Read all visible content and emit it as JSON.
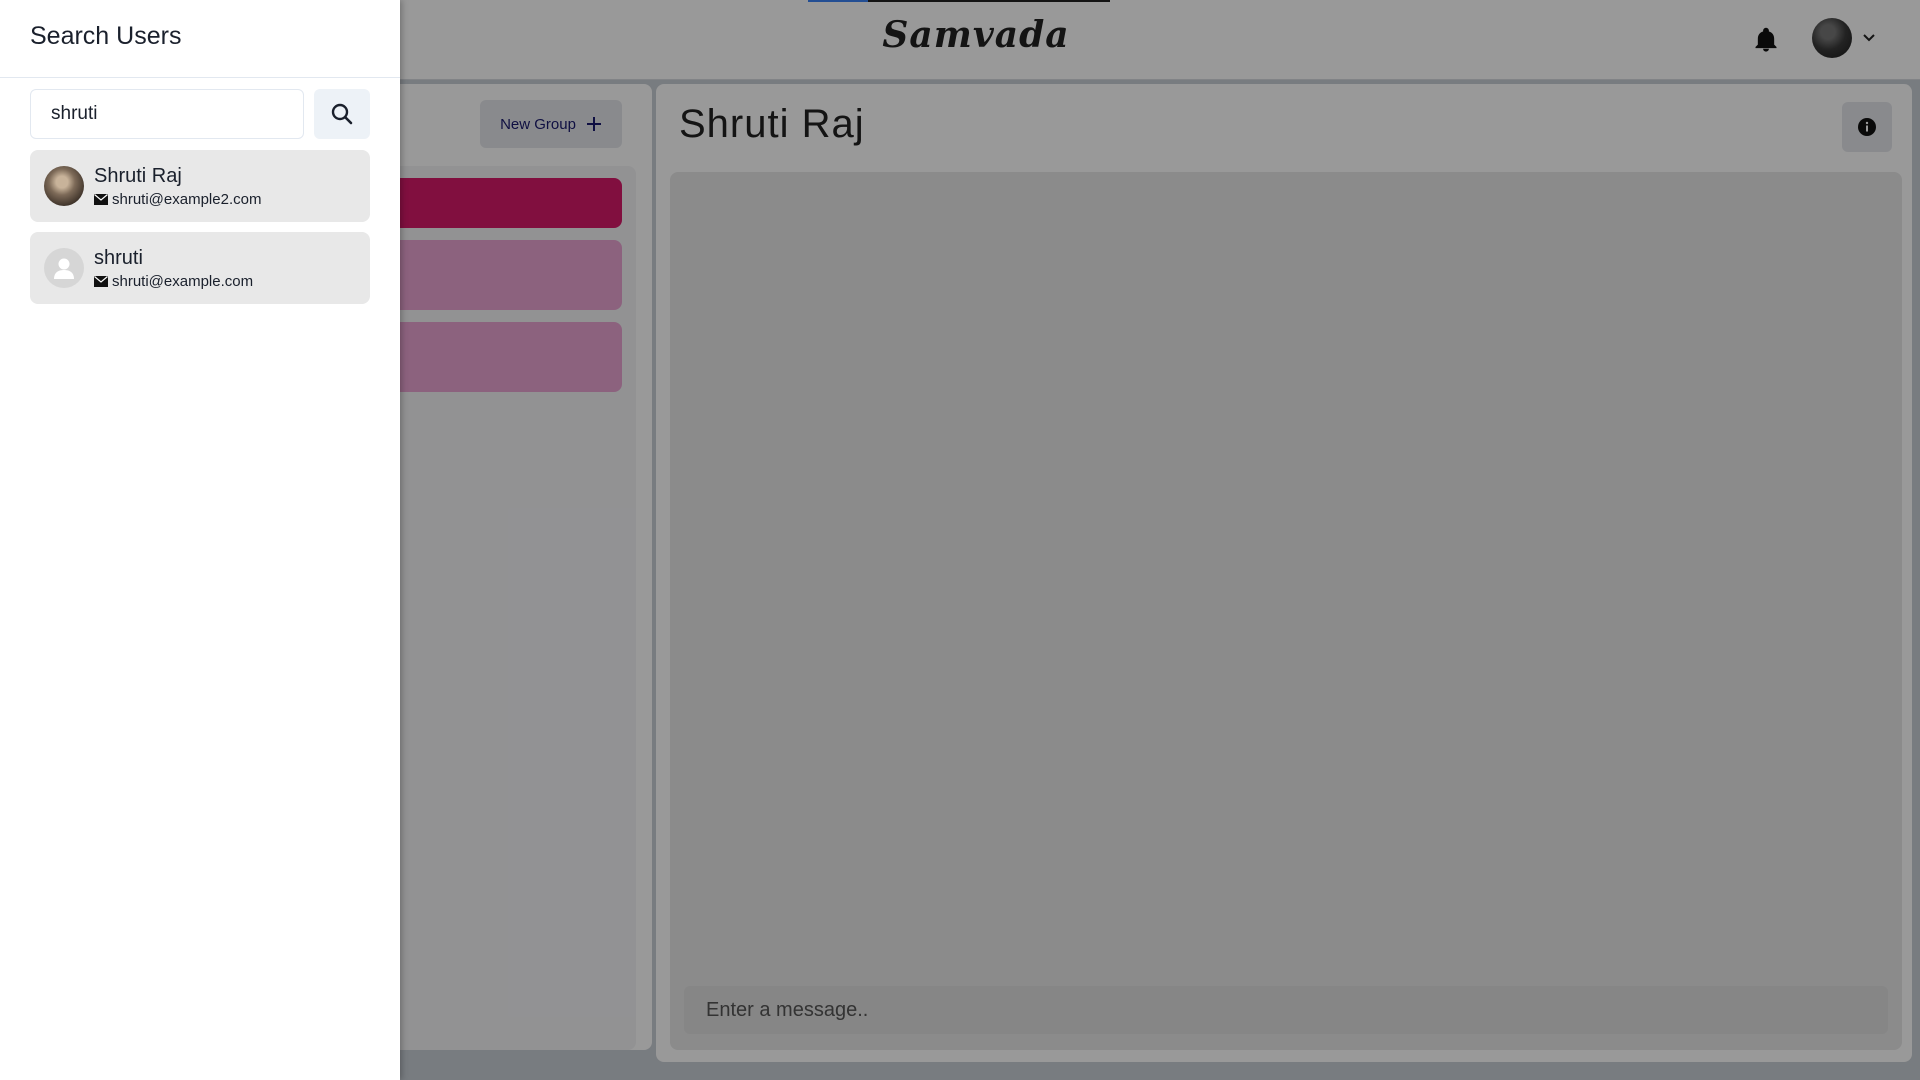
{
  "app": {
    "brand": "Samvada",
    "new_group_label": "New Group",
    "chat_title": "Shruti Raj",
    "message_placeholder": "Enter a message.."
  },
  "drawer": {
    "title": "Search Users",
    "search_value": "shruti",
    "results": [
      {
        "name": "Shruti Raj",
        "email": "shruti@example2.com"
      },
      {
        "name": "shruti",
        "email": "shruti@example.com"
      }
    ]
  },
  "colors": {
    "active_chat": "#d7196a",
    "chat_item": "#e9a4d3",
    "brand_text": "#222222"
  },
  "icons": [
    "bell-icon",
    "chevron-down-icon",
    "plus-icon",
    "info-icon",
    "search-icon",
    "mail-icon",
    "user-icon"
  ]
}
